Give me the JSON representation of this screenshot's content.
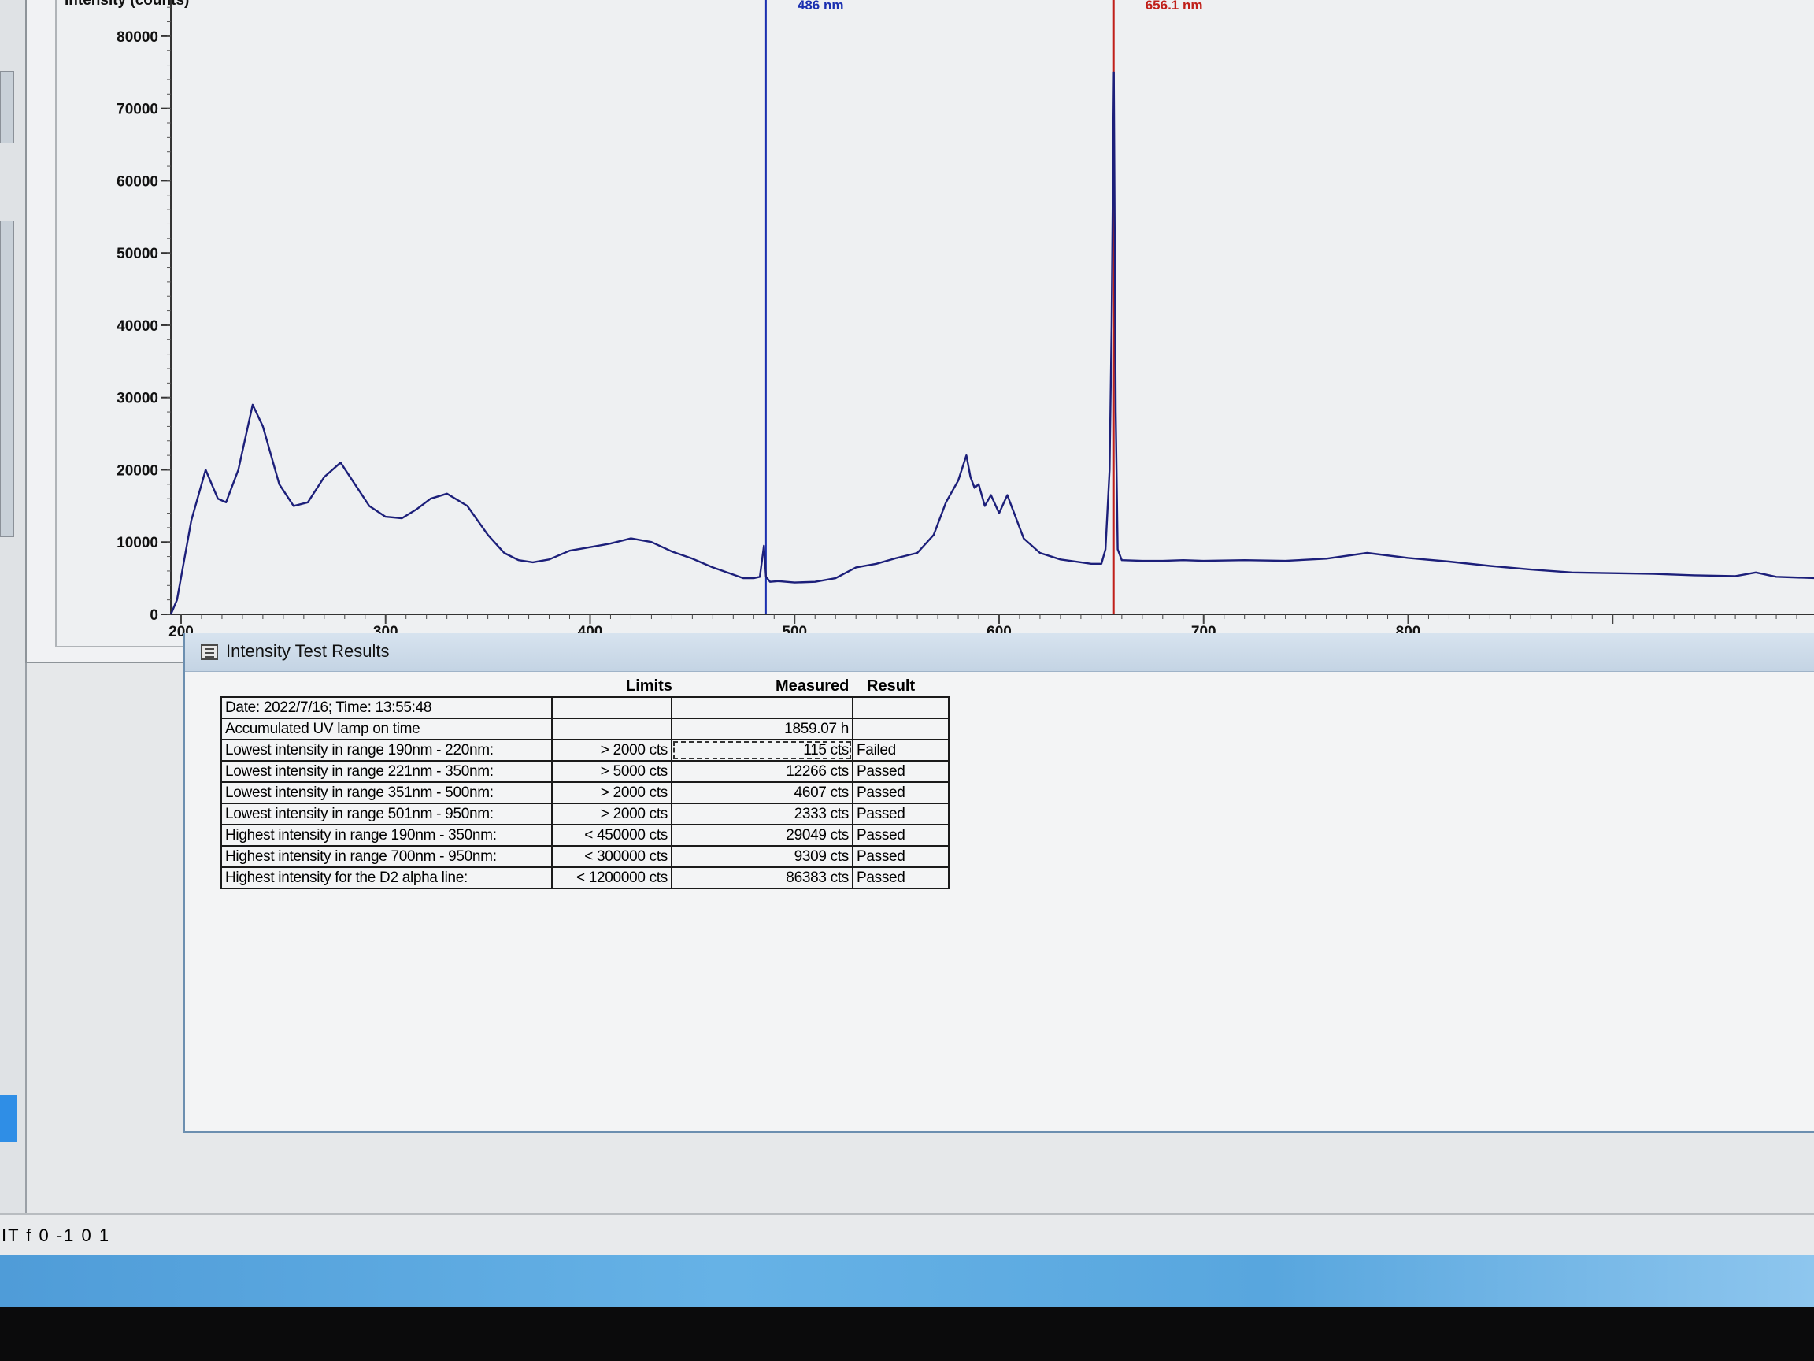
{
  "chart": {
    "y_axis_title": "Intensity (counts)",
    "markers": [
      {
        "label": "486 nm",
        "color": "#1a2fb0",
        "wavelength": 486
      },
      {
        "label": "656.1 nm",
        "color": "#c0201a",
        "wavelength": 656.1
      }
    ]
  },
  "chart_data": {
    "type": "line",
    "xlabel": "",
    "ylabel": "Intensity (counts)",
    "xlim": [
      195,
      1000
    ],
    "ylim": [
      0,
      85000
    ],
    "x_ticks": [
      200,
      300,
      400,
      500,
      600,
      700,
      800
    ],
    "y_ticks": [
      0,
      10000,
      20000,
      30000,
      40000,
      50000,
      60000,
      70000,
      80000
    ],
    "grid": false,
    "series": [
      {
        "color": "#1c1f7a",
        "x": [
          195,
          198,
          205,
          212,
          218,
          222,
          228,
          235,
          240,
          248,
          255,
          262,
          270,
          278,
          285,
          292,
          300,
          308,
          315,
          322,
          330,
          340,
          350,
          358,
          365,
          372,
          380,
          390,
          400,
          410,
          420,
          430,
          440,
          450,
          460,
          470,
          475,
          480,
          483,
          485,
          486,
          488,
          492,
          500,
          510,
          520,
          530,
          540,
          550,
          560,
          568,
          574,
          580,
          584,
          586,
          588,
          590,
          593,
          596,
          600,
          604,
          608,
          612,
          620,
          630,
          640,
          645,
          650,
          652,
          654,
          655,
          656.1,
          657,
          658,
          660,
          670,
          680,
          690,
          700,
          720,
          740,
          760,
          780,
          800,
          820,
          840,
          860,
          880,
          900,
          920,
          940,
          960,
          970,
          980,
          1000
        ],
        "y": [
          0,
          2000,
          13000,
          20000,
          16000,
          15500,
          20000,
          29000,
          26000,
          18000,
          15000,
          15500,
          19000,
          21000,
          18000,
          15000,
          13500,
          13300,
          14500,
          16000,
          16700,
          15000,
          11000,
          8500,
          7500,
          7200,
          7600,
          8800,
          9300,
          9800,
          10500,
          10000,
          8700,
          7700,
          6500,
          5500,
          5000,
          5000,
          5200,
          9500,
          5200,
          4500,
          4600,
          4400,
          4500,
          5000,
          6500,
          7000,
          7800,
          8500,
          11000,
          15500,
          18500,
          22000,
          19000,
          17500,
          18000,
          15000,
          16500,
          14000,
          16500,
          13500,
          10500,
          8500,
          7600,
          7200,
          7000,
          7000,
          9000,
          20000,
          40000,
          75000,
          28000,
          9000,
          7500,
          7400,
          7400,
          7500,
          7400,
          7500,
          7400,
          7700,
          8500,
          7800,
          7300,
          6700,
          6200,
          5800,
          5700,
          5600,
          5400,
          5300,
          5800,
          5200,
          5000
        ]
      }
    ]
  },
  "results": {
    "title": "Intensity Test Results",
    "headers": {
      "limits": "Limits",
      "measured": "Measured",
      "result": "Result"
    },
    "rows": [
      {
        "label": "Date: 2022/7/16; Time: 13:55:48",
        "limit": "",
        "measured": "",
        "result": ""
      },
      {
        "label": "Accumulated UV lamp on time",
        "limit": "",
        "measured": "1859.07 h",
        "result": ""
      },
      {
        "label": "Lowest intensity in range 190nm - 220nm:",
        "limit": "> 2000 cts",
        "measured": "115 cts",
        "result": "Failed"
      },
      {
        "label": "Lowest intensity in range 221nm - 350nm:",
        "limit": "> 5000 cts",
        "measured": "12266 cts",
        "result": "Passed"
      },
      {
        "label": "Lowest intensity in range 351nm - 500nm:",
        "limit": "> 2000 cts",
        "measured": "4607 cts",
        "result": "Passed"
      },
      {
        "label": "Lowest intensity in range 501nm - 950nm:",
        "limit": "> 2000 cts",
        "measured": "2333 cts",
        "result": "Passed"
      },
      {
        "label": "Highest intensity in range 190nm - 350nm:",
        "limit": "< 450000 cts",
        "measured": "29049 cts",
        "result": "Passed"
      },
      {
        "label": "Highest intensity in range 700nm - 950nm:",
        "limit": "< 300000 cts",
        "measured": "9309 cts",
        "result": "Passed"
      },
      {
        "label": "Highest intensity for the D2 alpha line:",
        "limit": "< 1200000 cts",
        "measured": "86383 cts",
        "result": "Passed"
      }
    ]
  },
  "status": {
    "text": "IT f 0 -1 0 1"
  }
}
